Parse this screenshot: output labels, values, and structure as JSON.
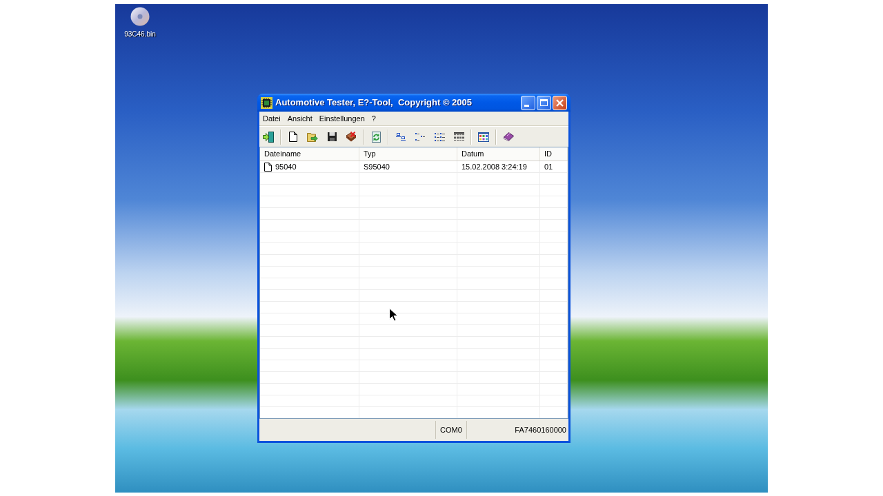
{
  "desktop_icons": [
    {
      "label": "93C46.bin"
    }
  ],
  "window": {
    "title": "Automotive Tester, E?-Tool,  Copyright © 2005"
  },
  "menu": [
    "Datei",
    "Ansicht",
    "Einstellungen",
    "?"
  ],
  "table": {
    "columns": [
      "Dateiname",
      "Typ",
      "Datum",
      "ID"
    ],
    "rows": [
      [
        "95040",
        "S95040",
        "15.02.2008 3:24:19",
        "01"
      ]
    ]
  },
  "status_bar": {
    "panels": [
      "COM0",
      "FA7460160000"
    ]
  }
}
